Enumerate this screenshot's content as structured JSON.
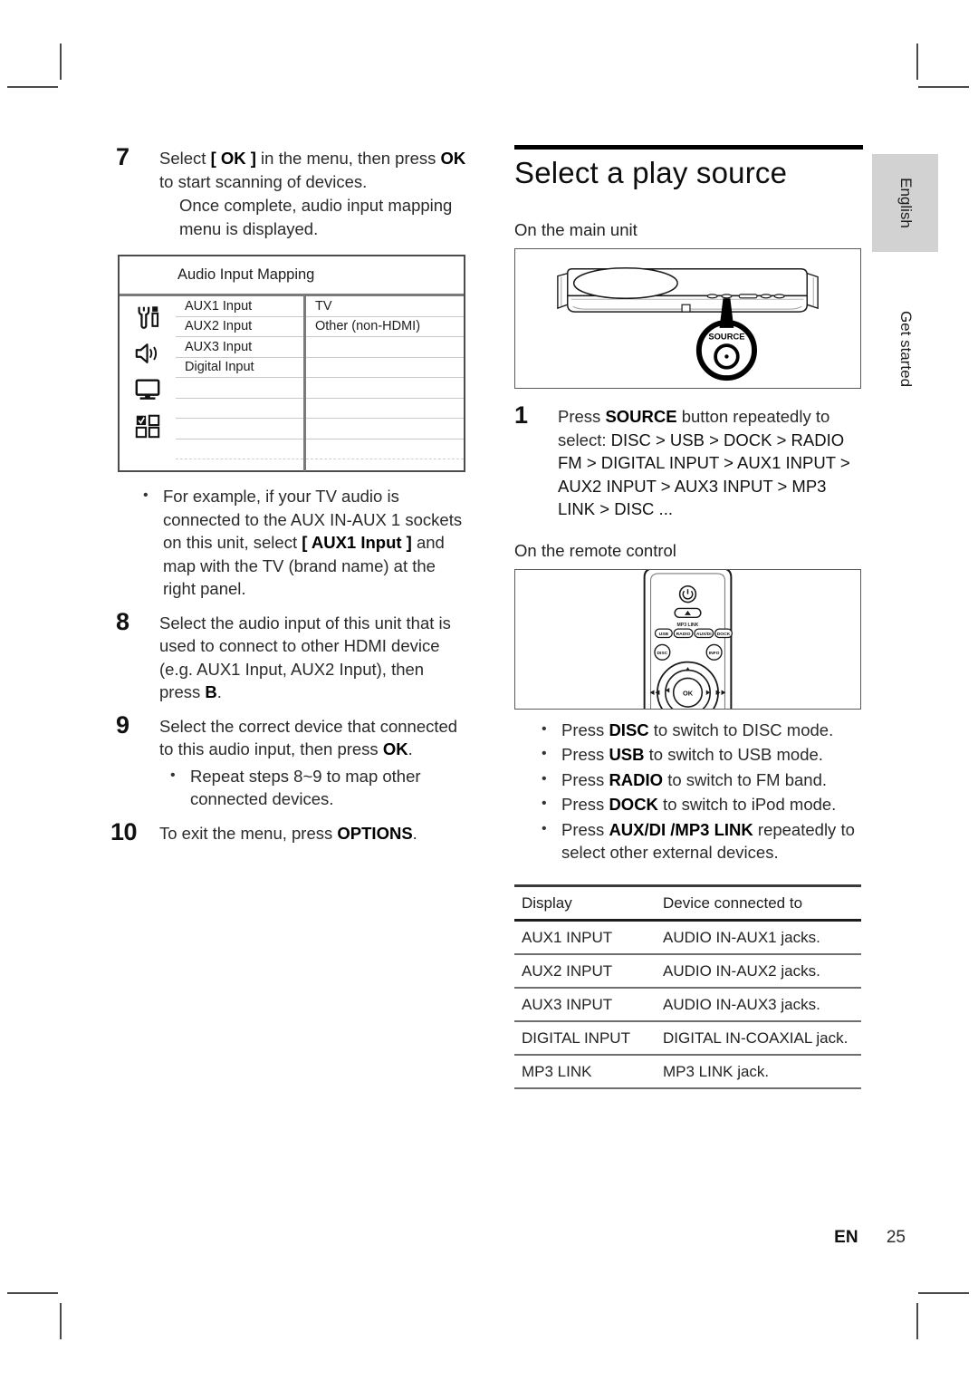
{
  "page": {
    "footer_lang": "EN",
    "footer_number": "25",
    "side_tab_language": "English",
    "side_tab_section": "Get started"
  },
  "left_column": {
    "steps": [
      {
        "number": "7",
        "text_parts": [
          {
            "t": "Select ",
            "style": "normal"
          },
          {
            "t": "[ OK ]",
            "style": "bold"
          },
          {
            "t": " in the menu, then press ",
            "style": "normal"
          },
          {
            "t": "OK",
            "style": "bold"
          },
          {
            "t": " to start scanning of devices.",
            "style": "normal"
          }
        ],
        "sub": "Once complete, audio input mapping menu is displayed."
      },
      {
        "number": "8",
        "text_parts": [
          {
            "t": "Select the audio input of this unit that is used to connect to other HDMI device (e.g. AUX1 Input, AUX2 Input), then press ",
            "style": "normal"
          },
          {
            "t": "B",
            "style": "bold"
          },
          {
            "t": ".",
            "style": "normal"
          }
        ]
      },
      {
        "number": "9",
        "text_parts": [
          {
            "t": "Select the correct device that connected to this audio input, then press ",
            "style": "normal"
          },
          {
            "t": "OK",
            "style": "bold"
          },
          {
            "t": ".",
            "style": "normal"
          }
        ],
        "bullet": "Repeat steps 8~9 to map other connected devices."
      },
      {
        "number": "10",
        "text_parts": [
          {
            "t": "To exit the menu, press ",
            "style": "normal"
          },
          {
            "t": "OPTIONS",
            "style": "bold"
          },
          {
            "t": ".",
            "style": "normal"
          }
        ]
      }
    ],
    "example_bullet_parts": [
      {
        "t": "For example, if your TV audio is connected to the AUX IN-AUX 1 sockets on this unit, select ",
        "style": "normal"
      },
      {
        "t": "[ AUX1 Input ]",
        "style": "bold"
      },
      {
        "t": " and map with the TV (brand name) at the right panel.",
        "style": "normal"
      }
    ],
    "osd": {
      "title": "Audio Input Mapping",
      "icons": [
        "settings-tools-icon",
        "speaker-audio-icon",
        "monitor-video-icon",
        "preferences-grid-icon"
      ],
      "rows": [
        {
          "input": "AUX1 Input",
          "device": "TV"
        },
        {
          "input": "AUX2 Input",
          "device": "Other (non-HDMI)"
        },
        {
          "input": "AUX3 Input",
          "device": ""
        },
        {
          "input": "Digital Input",
          "device": ""
        },
        {
          "input": "",
          "device": ""
        },
        {
          "input": "",
          "device": ""
        },
        {
          "input": "",
          "device": ""
        },
        {
          "input": "",
          "device": ""
        }
      ]
    }
  },
  "right_column": {
    "section_title": "Select a play source",
    "subhead_main_unit": "On the main unit",
    "subhead_remote": "On the remote control",
    "main_unit_figure": {
      "callout_label": "SOURCE"
    },
    "remote_figure": {
      "mp3_link_label": "MP3 LINK",
      "row_buttons": [
        "USB",
        "RADIO",
        "AUX/DI",
        "DOCK"
      ],
      "disc_button": "DISC",
      "info_button": "INFO",
      "ok_button": "OK"
    },
    "step1": {
      "number": "1",
      "lead_parts": [
        {
          "t": "Press ",
          "style": "normal"
        },
        {
          "t": "SOURCE",
          "style": "bold"
        },
        {
          "t": " button repeatedly to select: ",
          "style": "normal"
        }
      ],
      "sequence": "DISC > USB > DOCK > RADIO FM > DIGITAL INPUT > AUX1 INPUT > AUX2 INPUT > AUX3 INPUT > MP3 LINK > DISC ..."
    },
    "remote_bullets": [
      [
        {
          "t": "Press ",
          "style": "normal"
        },
        {
          "t": "DISC",
          "style": "bold"
        },
        {
          "t": " to switch to DISC mode.",
          "style": "normal"
        }
      ],
      [
        {
          "t": "Press ",
          "style": "normal"
        },
        {
          "t": "USB",
          "style": "bold"
        },
        {
          "t": " to switch to USB mode.",
          "style": "normal"
        }
      ],
      [
        {
          "t": "Press ",
          "style": "normal"
        },
        {
          "t": "RADIO",
          "style": "bold"
        },
        {
          "t": " to switch to FM band.",
          "style": "normal"
        }
      ],
      [
        {
          "t": "Press ",
          "style": "normal"
        },
        {
          "t": "DOCK",
          "style": "bold"
        },
        {
          "t": " to switch to iPod mode.",
          "style": "normal"
        }
      ],
      [
        {
          "t": "Press ",
          "style": "normal"
        },
        {
          "t": "AUX/DI /MP3 LINK",
          "style": "bold"
        },
        {
          "t": " repeatedly to select other external devices.",
          "style": "normal"
        }
      ]
    ],
    "device_table": {
      "headers": [
        "Display",
        "Device connected to"
      ],
      "rows": [
        {
          "display": "AUX1 INPUT",
          "device": "AUDIO IN-AUX1 jacks."
        },
        {
          "display": "AUX2 INPUT",
          "device": "AUDIO IN-AUX2 jacks."
        },
        {
          "display": "AUX3 INPUT",
          "device": "AUDIO IN-AUX3 jacks."
        },
        {
          "display": "DIGITAL INPUT",
          "device": "DIGITAL IN-COAXIAL jack."
        },
        {
          "display": "MP3 LINK",
          "device": "MP3 LINK jack."
        }
      ]
    }
  },
  "colors": {
    "tab_bg": "#d2d2d2",
    "rule": "#000000",
    "text": "#1a1a1a"
  }
}
